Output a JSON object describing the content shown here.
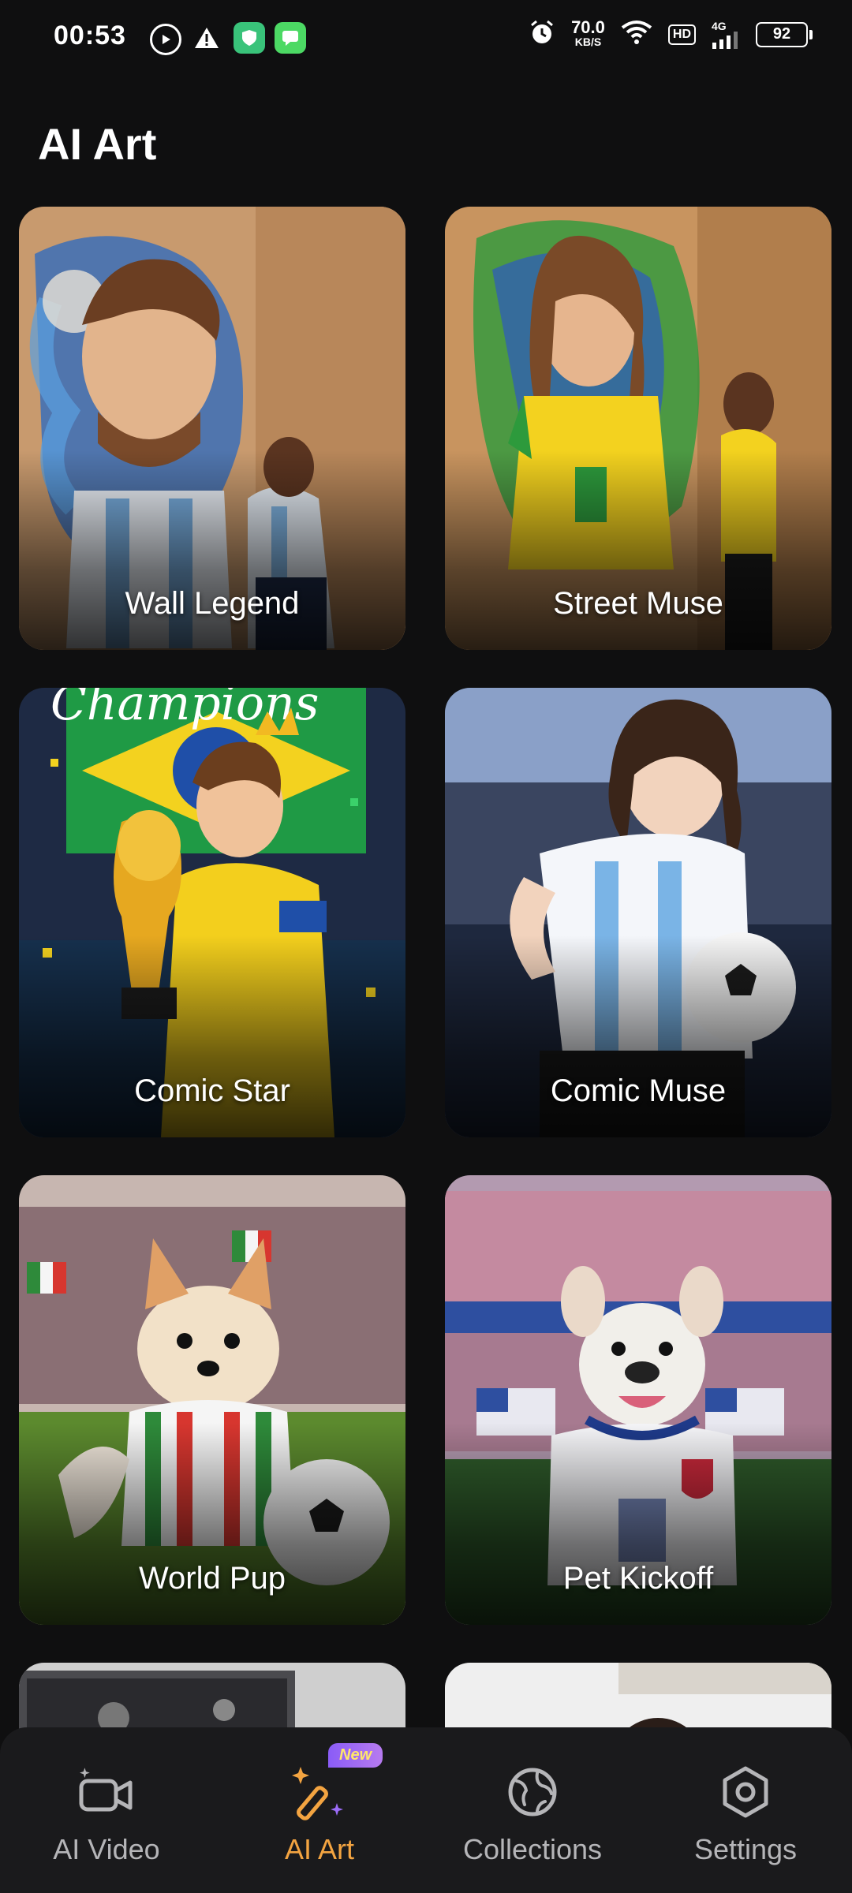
{
  "status_bar": {
    "time": "00:53",
    "speed_value": "70.0",
    "speed_unit": "KB/S",
    "network": "4G",
    "hd": "HD",
    "battery": "92",
    "icons": [
      "play-icon",
      "warning-icon",
      "shield-app-icon",
      "chat-app-icon",
      "alarm-icon",
      "wifi-icon",
      "signal-icon",
      "battery-icon"
    ]
  },
  "header": {
    "title": "AI Art"
  },
  "cards": [
    {
      "label": "Wall Legend",
      "image": "painter-mural-argentina"
    },
    {
      "label": "Street Muse",
      "image": "painter-mural-brazil"
    },
    {
      "label": "Comic Star",
      "image": "anime-champion-trophy"
    },
    {
      "label": "Comic Muse",
      "image": "anime-girl-argentina-ball"
    },
    {
      "label": "World Pup",
      "image": "chihuahua-mexico-jersey"
    },
    {
      "label": "Pet Kickoff",
      "image": "bulldog-usa-jersey"
    },
    {
      "label": "",
      "image": "partial-editing-screen"
    },
    {
      "label": "",
      "image": "partial-room-portrait"
    }
  ],
  "bottom_nav": {
    "items": [
      {
        "label": "AI Video",
        "icon": "video-camera-icon",
        "active": false
      },
      {
        "label": "AI Art",
        "icon": "magic-wand-icon",
        "active": true,
        "badge": "New"
      },
      {
        "label": "Collections",
        "icon": "globe-icon",
        "active": false
      },
      {
        "label": "Settings",
        "icon": "settings-hexagon-icon",
        "active": false
      }
    ]
  },
  "colors": {
    "background": "#0f0f10",
    "accent": "#f3a441",
    "nav_bg": "#1a1a1c",
    "badge": "#8a5cf6"
  }
}
